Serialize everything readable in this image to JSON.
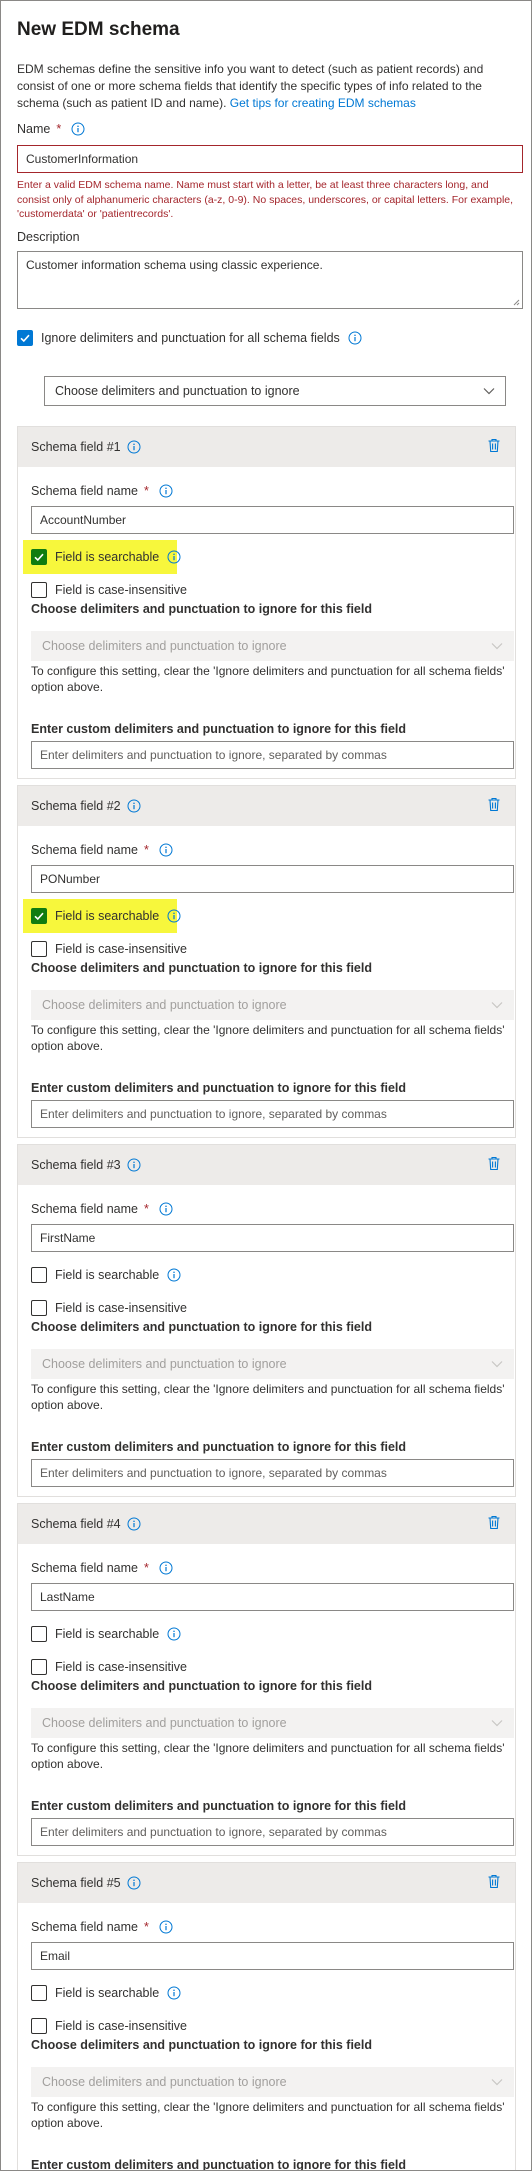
{
  "title": "New EDM schema",
  "intro": {
    "text": "EDM schemas define the sensitive info you want to detect (such as patient records) and consist of one or more schema fields that identify the specific types of info related to the schema (such as patient ID and name).",
    "link": "Get tips for creating EDM schemas"
  },
  "name": {
    "label": "Name",
    "required": "*",
    "value": "CustomerInformation",
    "error": "Enter a valid EDM schema name. Name must start with a letter, be at least three characters long, and consist only of alphanumeric characters (a-z, 0-9). No spaces, underscores, or capital letters. For example, 'customerdata' or 'patientrecords'."
  },
  "description": {
    "label": "Description",
    "value": "Customer information schema using classic experience."
  },
  "ignore_all": {
    "label": "Ignore delimiters and punctuation for all schema fields",
    "checked": true,
    "dropdown_placeholder": "Choose delimiters and punctuation to ignore"
  },
  "field_labels": {
    "field_name": "Schema field name",
    "required": "*",
    "searchable": "Field is searchable",
    "case_insensitive": "Field is case-insensitive",
    "choose_heading": "Choose delimiters and punctuation to ignore for this field",
    "choose_placeholder": "Choose delimiters and punctuation to ignore",
    "config_note": "To configure this setting, clear the 'Ignore delimiters and punctuation for all schema fields' option above.",
    "custom_heading": "Enter custom delimiters and punctuation to ignore for this field",
    "custom_placeholder": "Enter delimiters and punctuation to ignore, separated by commas"
  },
  "schema_fields": [
    {
      "title": "Schema field #1",
      "value": "AccountNumber",
      "searchable": true,
      "case_insensitive": false
    },
    {
      "title": "Schema field #2",
      "value": "PONumber",
      "searchable": true,
      "case_insensitive": false
    },
    {
      "title": "Schema field #3",
      "value": "FirstName",
      "searchable": false,
      "case_insensitive": false
    },
    {
      "title": "Schema field #4",
      "value": "LastName",
      "searchable": false,
      "case_insensitive": false
    },
    {
      "title": "Schema field #5",
      "value": "Email",
      "searchable": false,
      "case_insensitive": false
    }
  ],
  "colors": {
    "accent": "#0078d4",
    "error": "#a4262c",
    "highlight": "#f7f73c",
    "searchable_check": "#107c10",
    "section_header": "#edebe9"
  }
}
